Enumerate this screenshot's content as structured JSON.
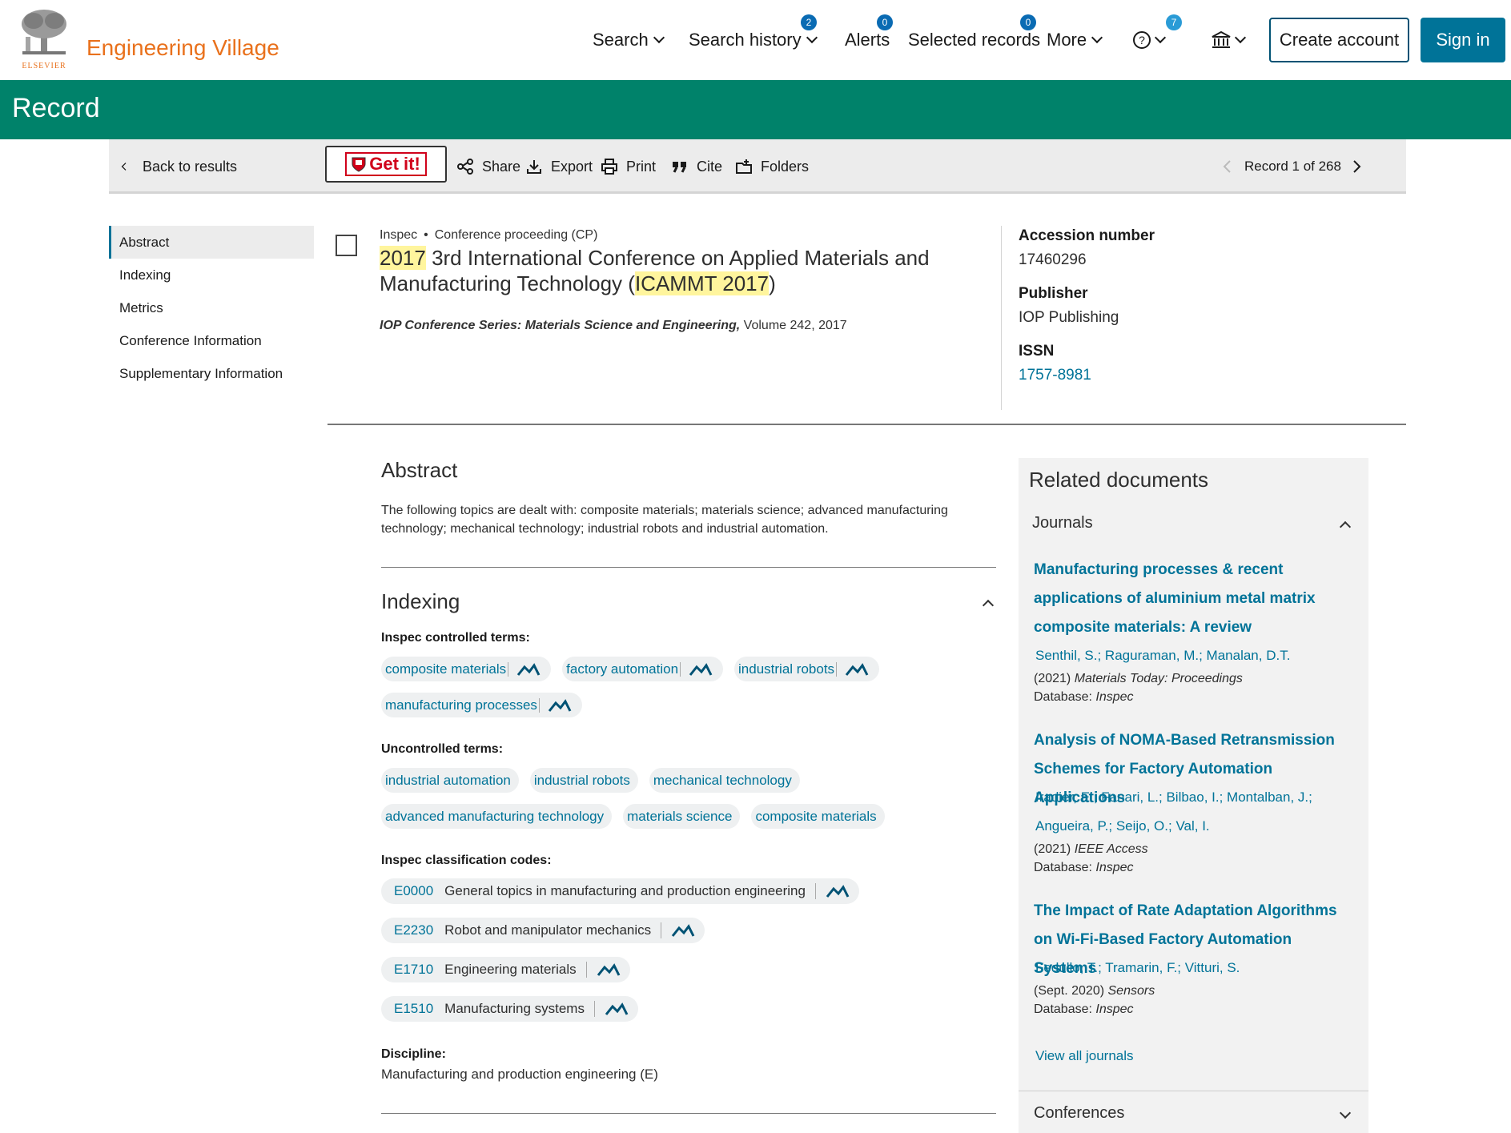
{
  "header": {
    "publisher_logo_text": "ELSEVIER",
    "brand": "Engineering Village",
    "nav": {
      "search": "Search",
      "search_history": "Search history",
      "search_history_badge": "2",
      "alerts": "Alerts",
      "alerts_badge": "0",
      "selected_records": "Selected records",
      "selected_records_badge": "0",
      "more": "More",
      "help_badge": "7"
    },
    "create_account": "Create account",
    "sign_in": "Sign in"
  },
  "banner": {
    "title": "Record"
  },
  "toolbar": {
    "back": "Back to results",
    "getit": "Get it!",
    "share": "Share",
    "export": "Export",
    "print": "Print",
    "cite": "Cite",
    "folders": "Folders",
    "record_position": "Record 1 of 268"
  },
  "leftnav": {
    "items": [
      "Abstract",
      "Indexing",
      "Metrics",
      "Conference Information",
      "Supplementary Information"
    ]
  },
  "record": {
    "database": "Inspec",
    "doc_type": "Conference proceeding (CP)",
    "title_hl1": "2017",
    "title_mid": " 3rd International Conference on Applied Materials and Manufacturing Technology (",
    "title_hl2": "ICAMMT 2017",
    "title_end": ")",
    "series_name": "IOP Conference Series: Materials Science and Engineering,",
    "series_rest": " Volume 242, 2017"
  },
  "right_meta": {
    "accession_label": "Accession number",
    "accession_value": "17460296",
    "publisher_label": "Publisher",
    "publisher_value": "IOP Publishing",
    "issn_label": "ISSN",
    "issn_value": "1757-8981"
  },
  "abstract": {
    "heading": "Abstract",
    "text": "The following topics are dealt with: composite materials; materials science; advanced manufacturing technology; mechanical technology; industrial robots and industrial automation."
  },
  "indexing": {
    "heading": "Indexing",
    "controlled_label": "Inspec controlled terms:",
    "controlled_terms": [
      "composite materials",
      "factory automation",
      "industrial robots",
      "manufacturing processes"
    ],
    "uncontrolled_label": "Uncontrolled terms:",
    "uncontrolled_terms": [
      "industrial automation",
      "industrial robots",
      "mechanical technology",
      "advanced manufacturing technology",
      "materials science",
      "composite materials"
    ],
    "classification_label": "Inspec classification codes:",
    "codes": [
      {
        "code": "E0000",
        "desc": "General topics in manufacturing and production engineering"
      },
      {
        "code": "E2230",
        "desc": "Robot and manipulator mechanics"
      },
      {
        "code": "E1710",
        "desc": "Engineering materials"
      },
      {
        "code": "E1510",
        "desc": "Manufacturing systems"
      }
    ],
    "discipline_label": "Discipline:",
    "discipline_value": "Manufacturing and production engineering (E)"
  },
  "related": {
    "heading": "Related documents",
    "journals_label": "Journals",
    "docs": [
      {
        "title": "Manufacturing processes & recent applications of aluminium metal matrix composite materials: A review",
        "authors": "Senthil, S.; Raguraman, M.; Manalan, D.T.",
        "source_prefix": "(2021) ",
        "source_name": "Materials Today: Proceedings",
        "db_label": "Database: ",
        "db_value": "Inspec"
      },
      {
        "title": "Analysis of NOMA-Based Retransmission Schemes for Factory Automation Applications",
        "authors": "Iradier, E.; Fanari, L.; Bilbao, I.; Montalban, J.; Angueira, P.; Seijo, O.;    Val, I.",
        "source_prefix": "(2021) ",
        "source_name": "IEEE Access",
        "db_label": "Database: ",
        "db_value": "Inspec"
      },
      {
        "title": "The Impact of Rate Adaptation Algorithms on Wi-Fi-Based Factory Automation Systems",
        "authors": "Fedullo, T.; Tramarin, F.; Vitturi, S.",
        "source_prefix": "(Sept. 2020) ",
        "source_name": "Sensors",
        "db_label": "Database: ",
        "db_value": "Inspec"
      }
    ],
    "view_all": "View all journals",
    "conferences_label": "Conferences"
  },
  "colors": {
    "brand_orange": "#e9711c",
    "banner_green": "#00826a",
    "link_blue": "#007398",
    "badge_blue": "#0a6bb3",
    "highlight": "#fff59d"
  }
}
